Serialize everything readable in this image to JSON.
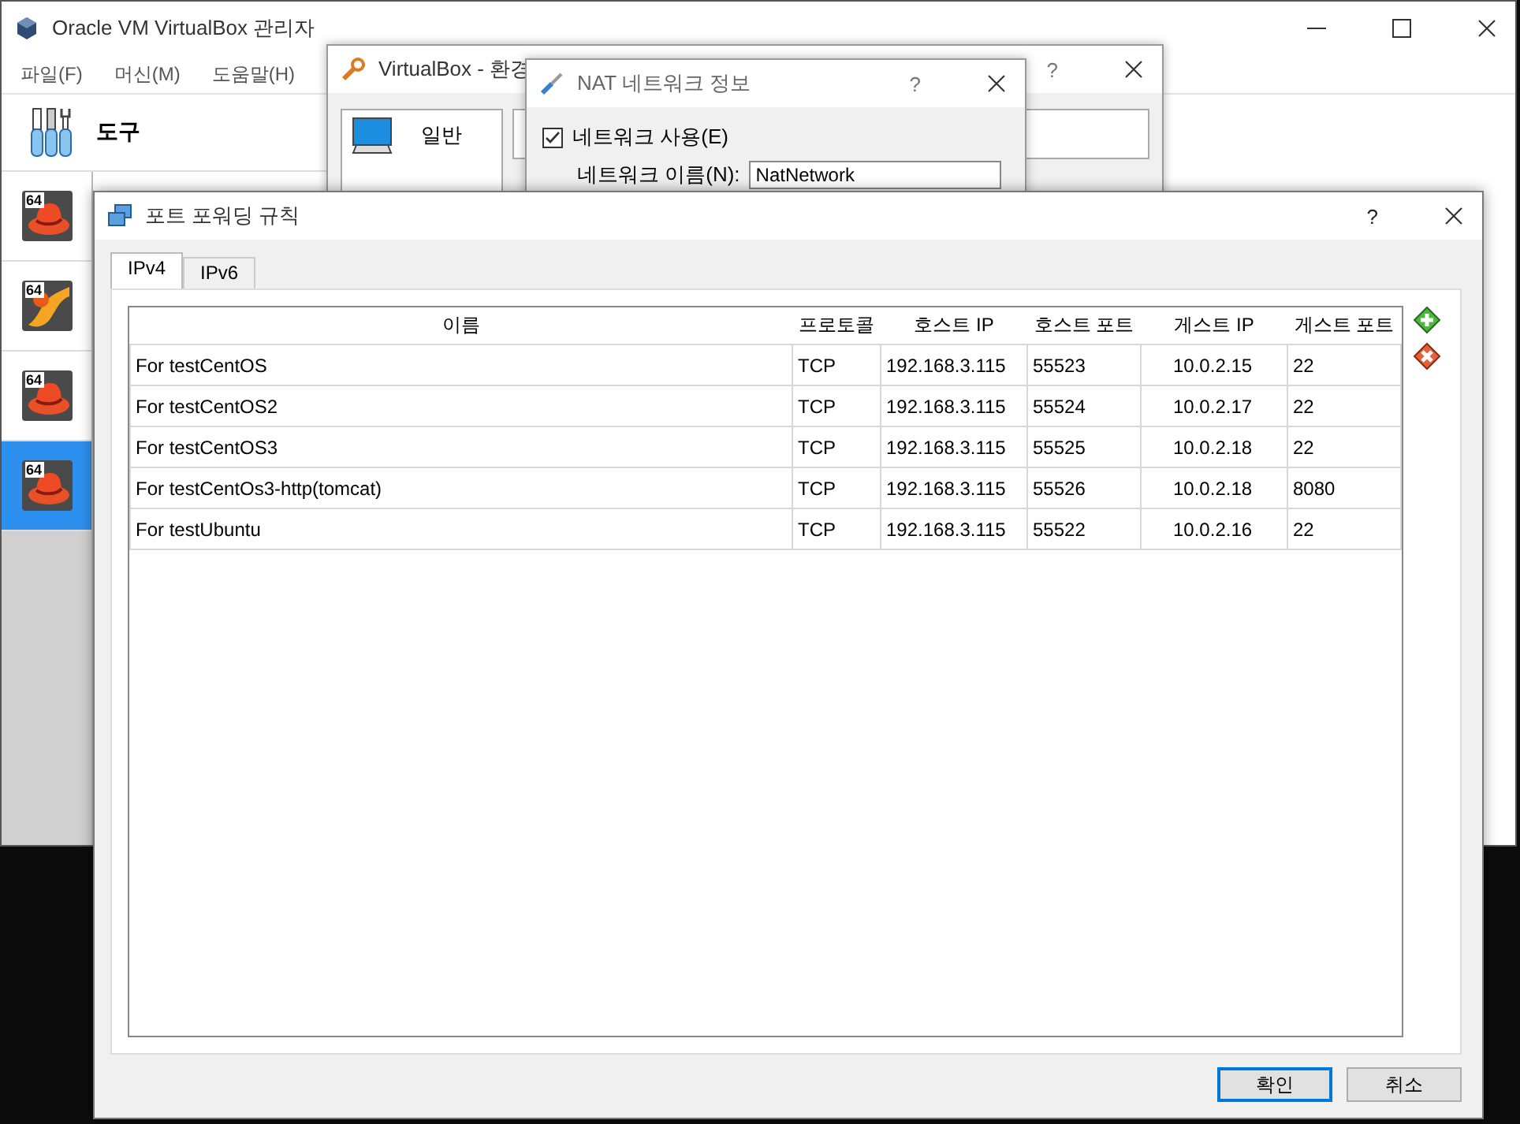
{
  "manager": {
    "title": "Oracle VM VirtualBox 관리자",
    "menu": [
      "파일(F)",
      "머신(M)",
      "도움말(H)"
    ],
    "tools_label": "도구",
    "machines": [
      {
        "kind": "redhat",
        "badge": "64",
        "selected": false
      },
      {
        "kind": "other",
        "badge": "64",
        "selected": false
      },
      {
        "kind": "redhat",
        "badge": "64",
        "selected": false
      },
      {
        "kind": "redhat",
        "badge": "64",
        "selected": true
      }
    ]
  },
  "settings": {
    "title": "VirtualBox - 환경",
    "help": "?",
    "categories": [
      {
        "label": "일반"
      }
    ]
  },
  "nat": {
    "title": "NAT 네트워크 정보",
    "help": "?",
    "enable": {
      "label": "네트워크 사용(E)",
      "checked": true
    },
    "name_label": "네트워크 이름(N):",
    "name_value": "NatNetwork"
  },
  "port_forwarding": {
    "title": "포트 포워딩 규칙",
    "help": "?",
    "tabs": [
      {
        "label": "IPv4",
        "selected": true
      },
      {
        "label": "IPv6",
        "selected": false
      }
    ],
    "table": {
      "columns": [
        "이름",
        "프로토콜",
        "호스트 IP",
        "호스트 포트",
        "게스트 IP",
        "게스트 포트"
      ],
      "rows": [
        [
          "For testCentOS",
          "TCP",
          "192.168.3.115",
          "55523",
          "10.0.2.15",
          "22"
        ],
        [
          "For testCentOS2",
          "TCP",
          "192.168.3.115",
          "55524",
          "10.0.2.17",
          "22"
        ],
        [
          "For testCentOS3",
          "TCP",
          "192.168.3.115",
          "55525",
          "10.0.2.18",
          "22"
        ],
        [
          "For testCentOs3-http(tomcat)",
          "TCP",
          "192.168.3.115",
          "55526",
          "10.0.2.18",
          "8080"
        ],
        [
          "For testUbuntu",
          "TCP",
          "192.168.3.115",
          "55522",
          "10.0.2.16",
          "22"
        ]
      ]
    },
    "buttons": [
      {
        "label": "확인",
        "default": true
      },
      {
        "label": "취소",
        "default": false
      }
    ]
  }
}
